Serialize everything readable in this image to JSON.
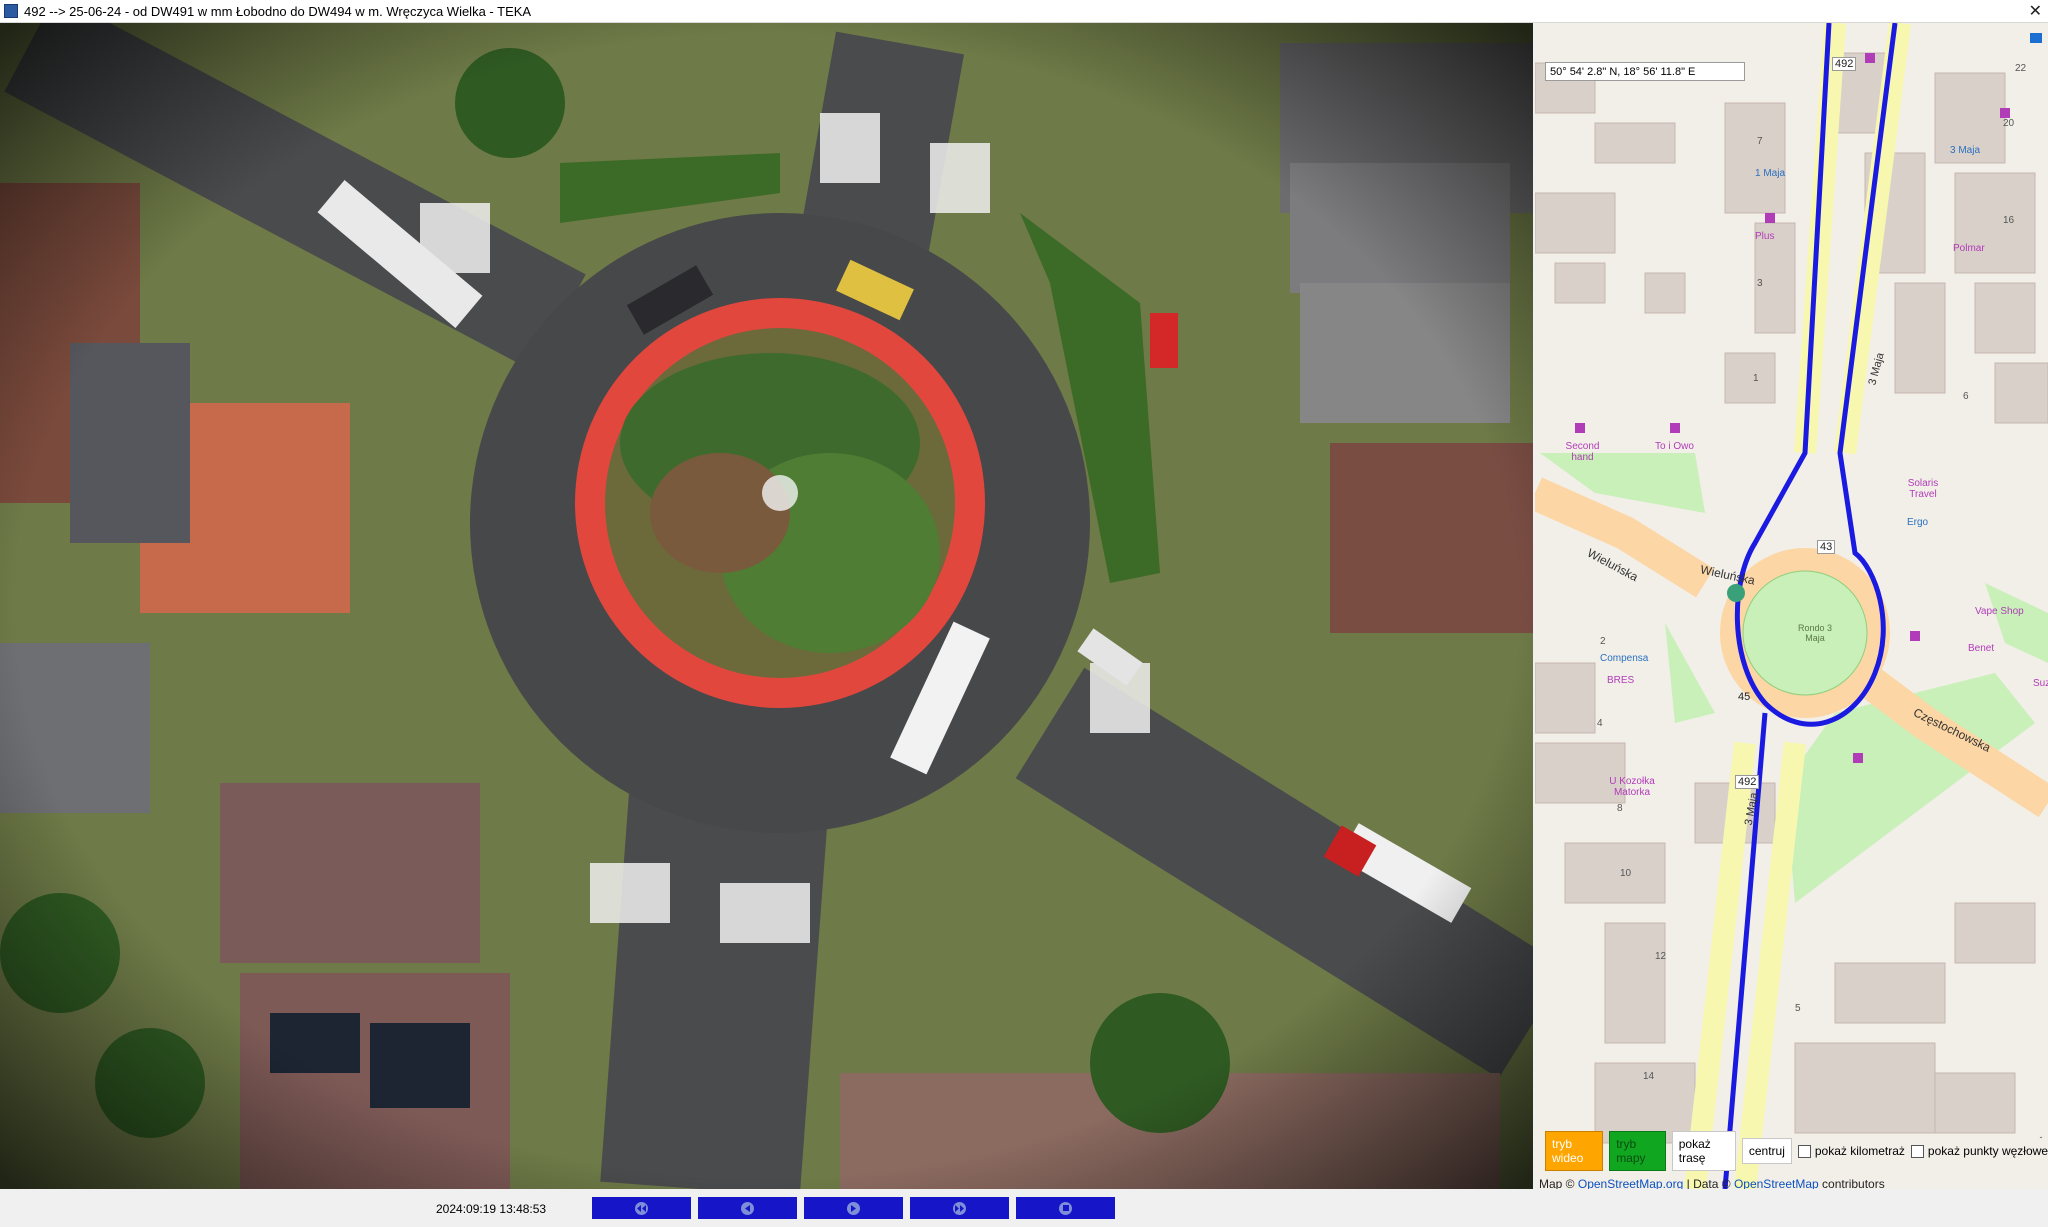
{
  "window": {
    "title": "492 --> 25-06-24 - od DW491 w mm Łobodno do DW494 w m. Wręczyca Wielka - TEKA",
    "close_icon": "close-icon"
  },
  "video": {
    "timestamp": "2024:09:19 13:48:53",
    "controls": [
      {
        "name": "rewind-fast-button",
        "icon": "fast-rewind-icon"
      },
      {
        "name": "step-back-button",
        "icon": "step-back-icon"
      },
      {
        "name": "play-button",
        "icon": "play-icon"
      },
      {
        "name": "fast-forward-button",
        "icon": "fast-forward-icon"
      },
      {
        "name": "stop-button",
        "icon": "stop-icon"
      }
    ]
  },
  "map": {
    "coordinates": "50° 54' 2.8\" N, 18° 56' 11.8\" E",
    "labels": {
      "roundabout_name": "Rondo 3 Maja",
      "street_wielunska_1": "Wieluńska",
      "street_wielunska_2": "Wieluńska",
      "street_czestochowska": "Częstochowska",
      "street_3maja_north": "3 Maja",
      "street_3maja_south": "3 Maja",
      "shop_1_maja": "1 Maja",
      "shop_plus": "Plus",
      "shop_second_hand": "Second hand",
      "shop_to_i_owo": "To i Owo",
      "shop_solaris": "Solaris Travel",
      "shop_vape": "Vape Shop",
      "shop_benet": "Benet",
      "shop_compensa": "Compensa",
      "shop_bres": "BRES",
      "shop_kozolka": "U Kozołka Matorka",
      "shop_polmar": "Polmar",
      "shop_ergo": "Ergo",
      "shop_suzu": "Suzu",
      "shop_3maja": "3 Maja",
      "route_492_top": "492",
      "route_492_bottom": "492",
      "route_43": "43",
      "route_45": "45",
      "house_7": "7",
      "house_3": "3",
      "house_1": "1",
      "house_2": "2",
      "house_4": "4",
      "house_8": "8",
      "house_10": "10",
      "house_12": "12",
      "house_14": "14",
      "house_16": "16",
      "house_20": "20",
      "house_22": "22",
      "house_5": "5",
      "house_6": "6"
    },
    "colors": {
      "route": "#1a1ae0",
      "main_road": "#fcd6a4",
      "secondary_road": "#f7f7b0",
      "park": "#c8f0b8",
      "building": "#d9d0c9"
    },
    "buttons": {
      "video_mode": "tryb wideo",
      "map_mode": "tryb mapy",
      "show_route": "pokaż trasę",
      "center": "centruj"
    },
    "checkboxes": {
      "show_km": "pokaż kilometraż",
      "show_nodes": "pokaż punkty węzłowe"
    },
    "attribution": {
      "prefix": "Map ©",
      "osm_org": "OpenStreetMap.org",
      "separator": "| Data ©",
      "osm": "OpenStreetMap",
      "suffix": "contributors"
    },
    "scroll_up": "-",
    "scroll_down": "-"
  }
}
